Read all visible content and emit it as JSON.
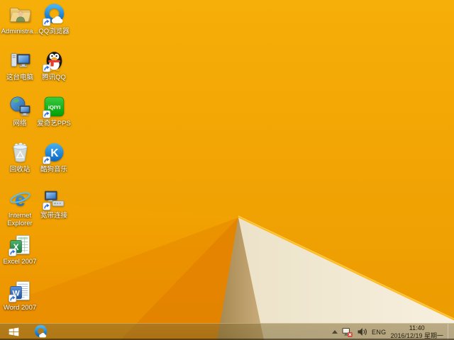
{
  "desktop": {
    "icons": [
      {
        "label": "Administra...",
        "icon": "user-folder-icon",
        "shortcut": false
      },
      {
        "label": "QQ浏览器",
        "icon": "qq-browser-icon",
        "shortcut": true
      },
      {
        "label": "这台电脑",
        "icon": "this-pc-icon",
        "shortcut": false
      },
      {
        "label": "腾讯QQ",
        "icon": "qq-penguin-icon",
        "shortcut": true
      },
      {
        "label": "网络",
        "icon": "network-globe-icon",
        "shortcut": false
      },
      {
        "label": "爱奇艺PPS",
        "icon": "iqiyi-pps-icon",
        "shortcut": true
      },
      {
        "label": "回收站",
        "icon": "recycle-bin-icon",
        "shortcut": false
      },
      {
        "label": "酷狗音乐",
        "icon": "kugou-music-icon",
        "shortcut": true
      },
      {
        "label": "Internet Explorer",
        "icon": "internet-explorer-icon",
        "shortcut": false
      },
      {
        "label": "宽带连接",
        "icon": "broadband-connection-icon",
        "shortcut": true
      },
      {
        "label": "Excel 2007",
        "icon": "excel-icon",
        "shortcut": true
      },
      {
        "label": "Word 2007",
        "icon": "word-icon",
        "shortcut": true
      }
    ]
  },
  "taskbar": {
    "pinned": [
      {
        "icon": "qq-browser-icon"
      }
    ],
    "tray": {
      "language": "ENG",
      "time": "11:40",
      "date": "2016/12/19 星期一"
    }
  },
  "colors": {
    "wallpaper_orange": "#F3A905",
    "wallpaper_orange_dark": "#E28200",
    "wallpaper_tan": "#B7975F",
    "wallpaper_cream": "#F2EAD3",
    "fold_highlight": "#FFBB22",
    "taskbar_tint": "#C0955B",
    "tray_text": "#26200F",
    "error_badge_red": "#D23B30"
  }
}
